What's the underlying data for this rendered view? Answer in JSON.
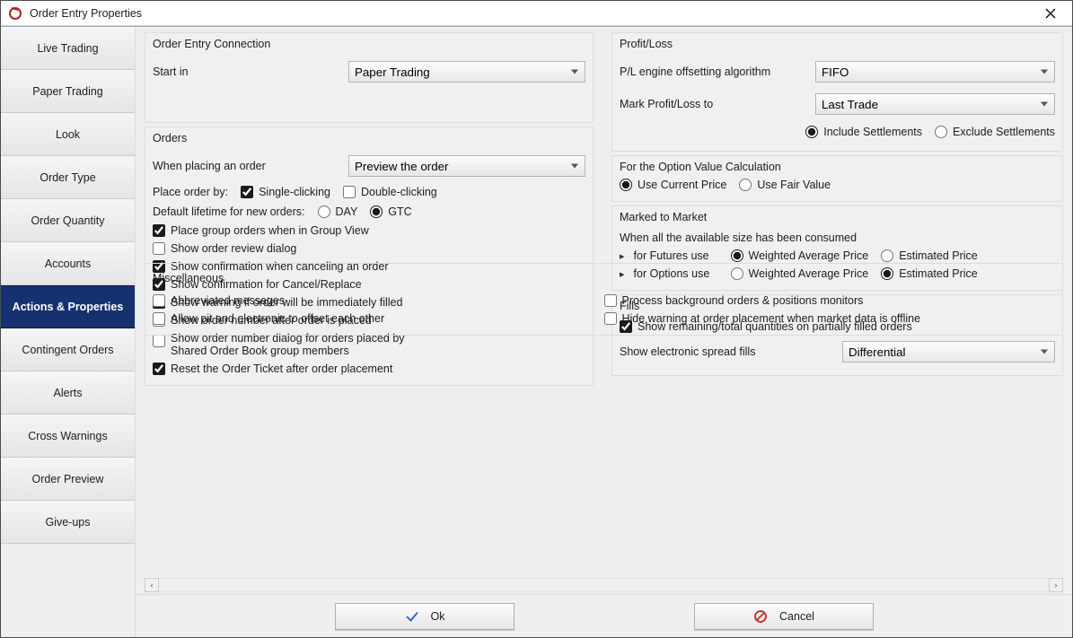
{
  "window": {
    "title": "Order Entry Properties"
  },
  "sidebar": {
    "items": [
      {
        "label": "Live Trading"
      },
      {
        "label": "Paper Trading"
      },
      {
        "label": "Look"
      },
      {
        "label": "Order Type"
      },
      {
        "label": "Order Quantity"
      },
      {
        "label": "Accounts"
      },
      {
        "label": "Actions & Properties"
      },
      {
        "label": "Contingent Orders"
      },
      {
        "label": "Alerts"
      },
      {
        "label": "Cross Warnings"
      },
      {
        "label": "Order Preview"
      },
      {
        "label": "Give-ups"
      }
    ],
    "active_index": 6
  },
  "sections": {
    "connection": {
      "title": "Order Entry Connection",
      "start_in_label": "Start in",
      "start_in_value": "Paper Trading"
    },
    "orders": {
      "title": "Orders",
      "when_placing_label": "When placing an order",
      "when_placing_value": "Preview the order",
      "place_order_by_label": "Place order by:",
      "place_order_by_options": {
        "single": "Single-clicking",
        "double": "Double-clicking"
      },
      "place_order_by_value": "single",
      "default_lifetime_label": "Default lifetime for new orders:",
      "default_lifetime_options": {
        "day": "DAY",
        "gtc": "GTC"
      },
      "default_lifetime_value": "gtc",
      "checks": [
        {
          "label": "Place group orders when in Group View",
          "checked": true
        },
        {
          "label": "Show order review dialog",
          "checked": false
        },
        {
          "label": "Show confirmation when canceling an order",
          "checked": true
        },
        {
          "label": "Show confirmation for Cancel/Replace",
          "checked": true
        },
        {
          "label": "Show warning if order will be immediately filled",
          "checked": true
        },
        {
          "label": "Show order number after order is placed",
          "checked": false
        },
        {
          "label": "Show order number dialog for orders placed by Shared Order Book group members",
          "checked": false
        },
        {
          "label": "Reset the Order Ticket after order placement",
          "checked": true
        }
      ]
    },
    "profitloss": {
      "title": "Profit/Loss",
      "algo_label": "P/L engine offsetting algorithm",
      "algo_value": "FIFO",
      "mark_label": "Mark Profit/Loss to",
      "mark_value": "Last Trade",
      "settle_options": {
        "include": "Include Settlements",
        "exclude": "Exclude Settlements"
      },
      "settle_value": "include"
    },
    "optionval": {
      "title": "For the Option Value Calculation",
      "options": {
        "current": "Use Current Price",
        "fair": "Use Fair Value"
      },
      "value": "current"
    },
    "marked": {
      "title": "Marked to Market",
      "intro": "When all the available size has been consumed",
      "futures_label": "for Futures use",
      "options_label": "for Options use",
      "opt_labels": {
        "wap": "Weighted Average Price",
        "est": "Estimated Price"
      },
      "futures_value": "wap",
      "options_value": "est"
    },
    "fills": {
      "title": "Fills",
      "show_remaining_label": "Show remaining/total quantities on partially filled orders",
      "show_remaining_checked": true,
      "spread_label": "Show electronic spread fills",
      "spread_value": "Differential"
    },
    "misc": {
      "title": "Miscellaneous",
      "left": [
        {
          "label": "Abbreviated messages",
          "checked": false
        },
        {
          "label": "Allow pit and electronic to offset each other",
          "checked": false
        }
      ],
      "right": [
        {
          "label": "Process background orders & positions monitors",
          "checked": false
        },
        {
          "label": "Hide warning at order placement when market data is offline",
          "checked": false
        }
      ]
    }
  },
  "buttons": {
    "ok": "Ok",
    "cancel": "Cancel"
  }
}
